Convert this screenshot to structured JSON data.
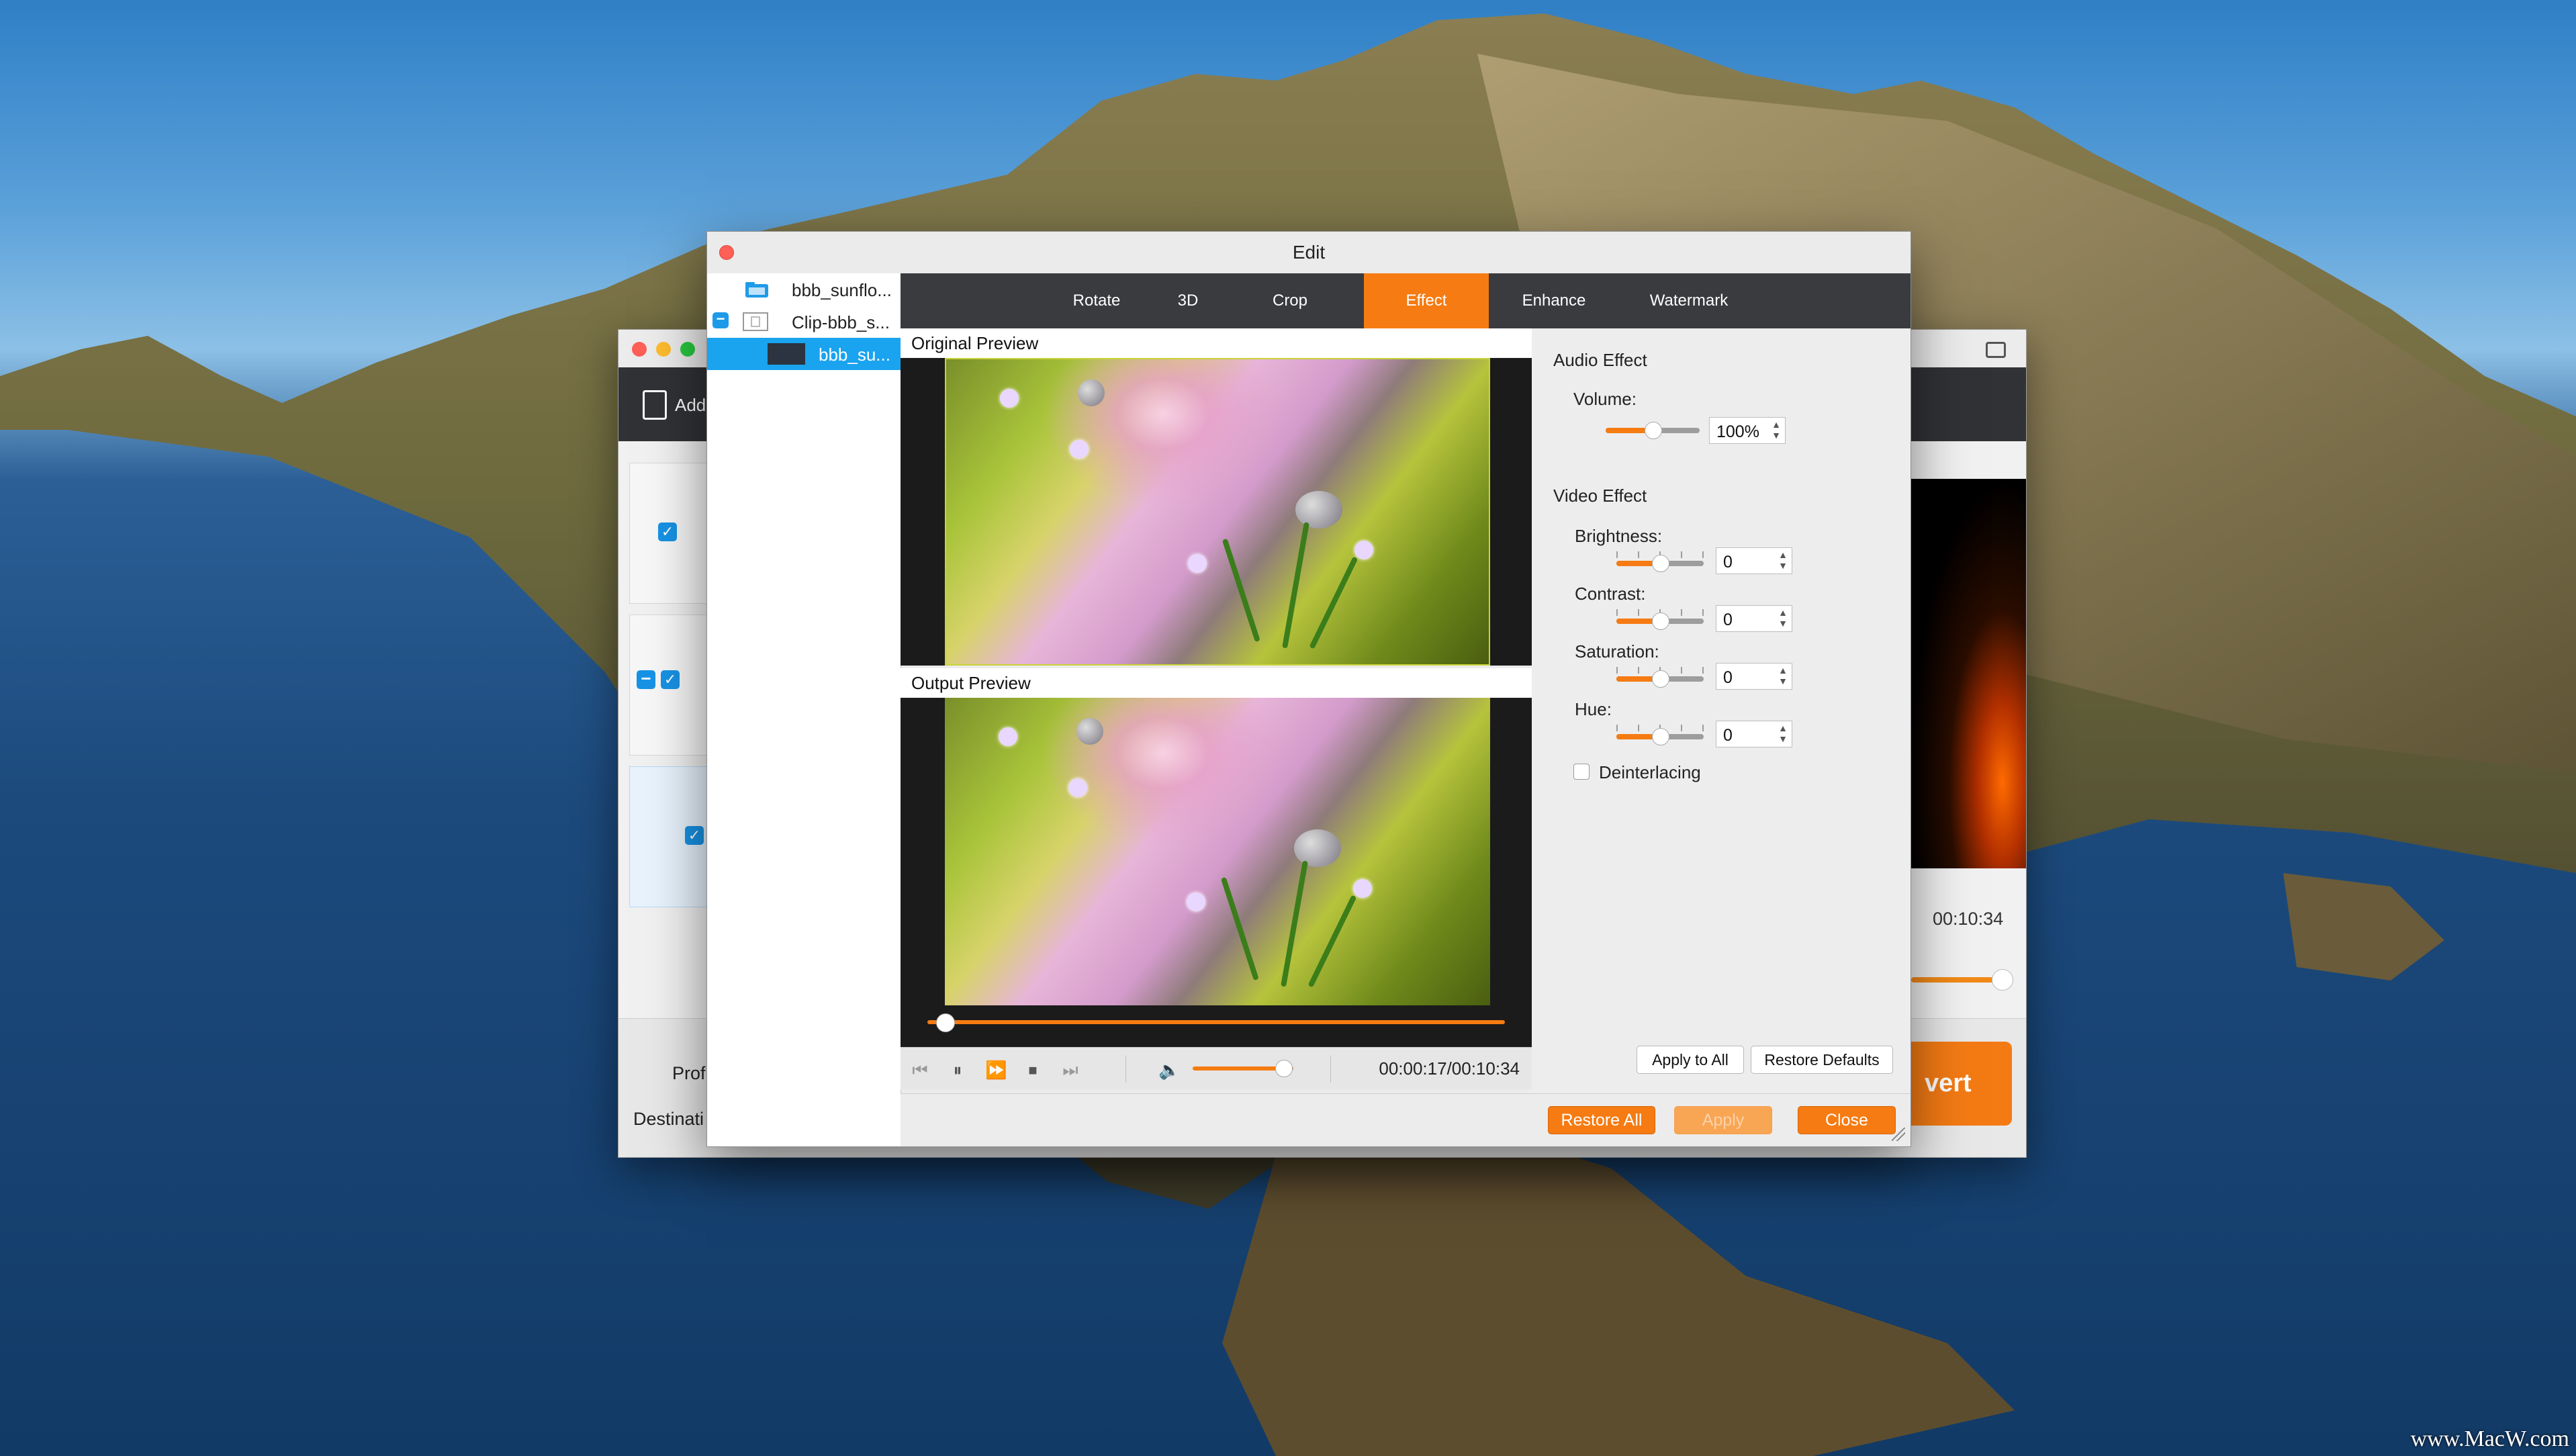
{
  "colors": {
    "accent": "#f57b12",
    "selection": "#1aa3ef",
    "tab_bar": "#3a3b3f"
  },
  "background_window": {
    "toolbar": {
      "add_label": "Add"
    },
    "profile_label": "Prof",
    "destination_label": "Destinati",
    "duration": "00:10:34",
    "convert_label": "vert"
  },
  "edit_dialog": {
    "title": "Edit",
    "files": [
      {
        "name": "bbb_sunflo...",
        "icon": "video-folder-icon"
      },
      {
        "name": "Clip-bbb_s...",
        "icon": "clip-thumbnail-icon"
      },
      {
        "name": "bbb_su...",
        "icon": "video-thumbnail-icon",
        "selected": true
      }
    ],
    "tabs": [
      {
        "label": "Rotate"
      },
      {
        "label": "3D"
      },
      {
        "label": "Crop"
      },
      {
        "label": "Effect",
        "active": true
      },
      {
        "label": "Enhance"
      },
      {
        "label": "Watermark"
      }
    ],
    "preview": {
      "original_label": "Original Preview",
      "output_label": "Output Preview",
      "time": "00:00:17/00:10:34",
      "playback_progress": 0.03,
      "playback_volume": 0.9
    },
    "audio_effect": {
      "heading": "Audio Effect",
      "volume_label": "Volume:",
      "volume_value": "100%",
      "volume_level": 0.5
    },
    "video_effect": {
      "heading": "Video Effect",
      "brightness_label": "Brightness:",
      "brightness_value": "0",
      "contrast_label": "Contrast:",
      "contrast_value": "0",
      "saturation_label": "Saturation:",
      "saturation_value": "0",
      "hue_label": "Hue:",
      "hue_value": "0",
      "deinterlacing_label": "Deinterlacing",
      "deinterlacing_checked": false
    },
    "buttons": {
      "apply_to_all": "Apply to All",
      "restore_defaults": "Restore Defaults",
      "restore_all": "Restore All",
      "apply": "Apply",
      "close": "Close"
    }
  },
  "watermark": "www.MacW.com"
}
